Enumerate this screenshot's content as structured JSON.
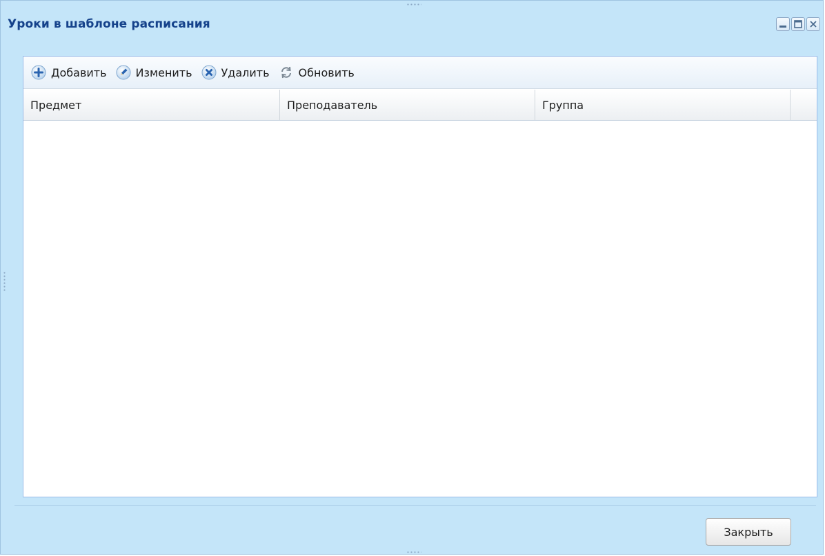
{
  "window": {
    "title": "Уроки в шаблоне расписания",
    "controls": [
      "minimize-icon",
      "maximize-icon",
      "close-icon"
    ]
  },
  "toolbar": {
    "add_label": "Добавить",
    "edit_label": "Изменить",
    "delete_label": "Удалить",
    "refresh_label": "Обновить"
  },
  "grid": {
    "columns": [
      "Предмет",
      "Преподаватель",
      "Группа"
    ],
    "rows": []
  },
  "footer": {
    "close_label": "Закрыть"
  },
  "colors": {
    "window_bg": "#c4e5f9",
    "title_text": "#15428b",
    "panel_border": "#99bbe8",
    "icon_blue": "#2a64b0"
  }
}
